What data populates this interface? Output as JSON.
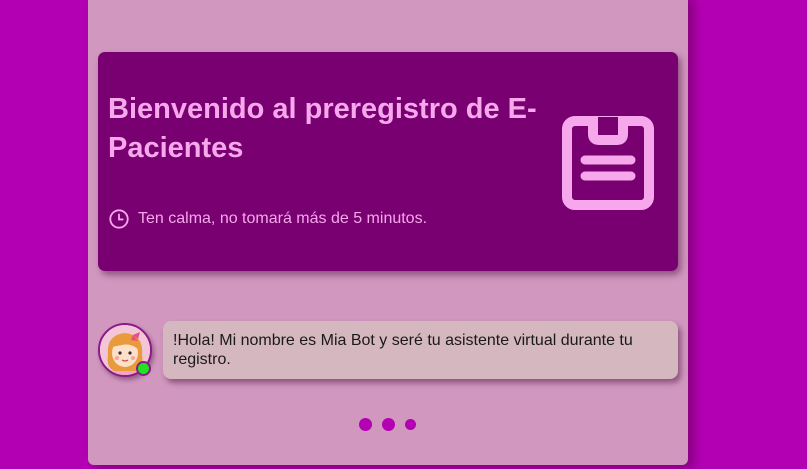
{
  "hero": {
    "title": "Bienvenido al preregistro de E-Pacientes",
    "note": "Ten calma, no tomará más de 5 minutos.",
    "icon": "clipboard-icon",
    "note_icon": "clock-icon"
  },
  "chat": {
    "bot_avatar_icon": "girl-avatar-icon",
    "status": "online",
    "message": "!Hola! Mi nombre es Mia Bot y seré tu asistente virtual durante tu registro."
  },
  "typing_indicator_dots": 3,
  "colors": {
    "background": "#b300b3",
    "panel": "#d197bf",
    "hero": "#780070",
    "hero_text": "#f7a8ec",
    "bubble": "#d5b7bf",
    "online": "#22e322"
  }
}
